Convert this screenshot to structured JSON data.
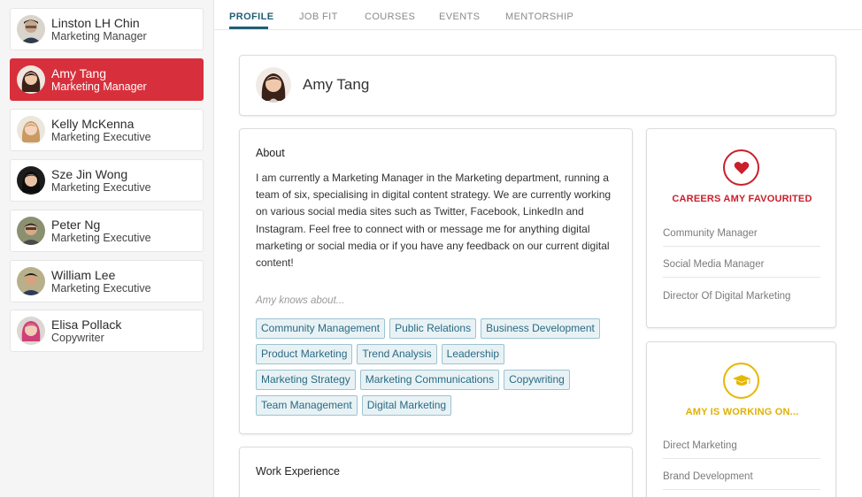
{
  "sidebar": {
    "people": [
      {
        "name": "Linston LH Chin",
        "role": "Marketing Manager",
        "active": false,
        "avatar_color": "#8b6b55"
      },
      {
        "name": "Amy Tang",
        "role": "Marketing Manager",
        "active": true,
        "avatar_color": "#5b3a2a"
      },
      {
        "name": "Kelly McKenna",
        "role": "Marketing Executive",
        "active": false,
        "avatar_color": "#c9a37a"
      },
      {
        "name": "Sze Jin Wong",
        "role": "Marketing Executive",
        "active": false,
        "avatar_color": "#2a2a2a"
      },
      {
        "name": "Peter Ng",
        "role": "Marketing Executive",
        "active": false,
        "avatar_color": "#6b6f57"
      },
      {
        "name": "William Lee",
        "role": "Marketing Executive",
        "active": false,
        "avatar_color": "#7a6a4a"
      },
      {
        "name": "Elisa Pollack",
        "role": "Copywriter",
        "active": false,
        "avatar_color": "#c4477a"
      }
    ]
  },
  "tabs": [
    {
      "label": "PROFILE",
      "active": true
    },
    {
      "label": "JOB FIT",
      "active": false
    },
    {
      "label": "COURSES",
      "active": false
    },
    {
      "label": "EVENTS",
      "active": false
    },
    {
      "label": "MENTORSHIP",
      "active": false
    }
  ],
  "profile": {
    "name": "Amy Tang",
    "about_heading": "About",
    "about_text": "I am currently a Marketing Manager in the Marketing department, running a team of six, specialising in digital content strategy. We are currently working on various social media sites such as Twitter, Facebook, LinkedIn and Instagram. Feel free to connect with or message me for anything digital marketing or social media or if you have any feedback on our current digital content!",
    "knows_about_label": "Amy knows about...",
    "skills": [
      [
        "Community Management",
        "Public Relations",
        "Business Development"
      ],
      [
        "Product Marketing",
        "Trend Analysis",
        "Leadership"
      ],
      [
        "Marketing Strategy",
        "Marketing Communications",
        "Copywriting"
      ],
      [
        "Team Management",
        "Digital Marketing"
      ]
    ],
    "work_heading": "Work Experience"
  },
  "favourites": {
    "title": "CAREERS AMY FAVOURITED",
    "icon": "heart-icon",
    "color": "#c8202c",
    "items": [
      "Community Manager",
      "Social Media Manager",
      "Director Of Digital Marketing"
    ]
  },
  "working_on": {
    "title": "AMY IS WORKING ON...",
    "icon": "graduation-cap-icon",
    "color": "#e6b800",
    "items": [
      "Direct Marketing",
      "Brand Development"
    ]
  }
}
